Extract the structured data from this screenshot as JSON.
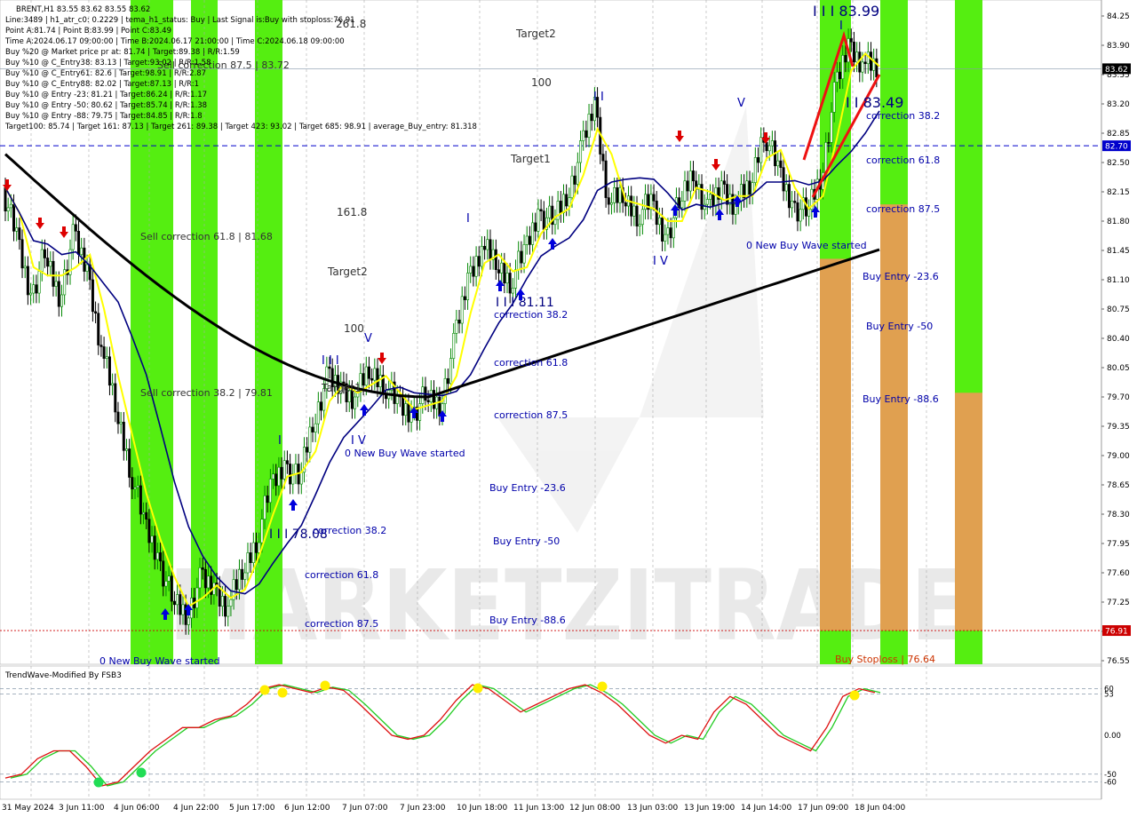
{
  "header": {
    "symbol_line": "BRENT,H1  83.55 83.62 83.55 83.62",
    "info_lines": [
      "Line:3489 | h1_atr_c0: 0.2229 | tema_h1_status: Buy | Last Signal is:Buy with stoploss:76.91",
      "Point A:81.74 | Point B:83.99 | Point C:83.49",
      "Time A:2024.06.17 09:00:00 | Time B:2024.06.17 21:00:00 | Time C:2024.06.18 09:00:00",
      "Buy %20 @ Market price pr at: 81.74 | Target:89.38 | R/R:1.59",
      "Buy %10 @ C_Entry38: 83.13 | Target:93.02 | R/R:1.58",
      "Buy %10 @ C_Entry61: 82.6 | Target:98.91 | R/R:2.87",
      "Buy %10 @ C_Entry88: 82.02 | Target:87.13 | R/R:1",
      "Buy %10 @ Entry -23: 81.21 | Target:86.24 | R/R:1.17",
      "Buy %10 @ Entry -50: 80.62 | Target:85.74 | R/R:1.38",
      "Buy %10 @ Entry -88: 79.75 | Target:84.85 | R/R:1.8",
      "Target100: 85.74 | Target 161: 87.13 | Target 261: 89.38 | Target 423: 93.02 | Target 685: 98.91 | average_Buy_entry: 81.318"
    ]
  },
  "chart_data": {
    "type": "candlestick",
    "symbol": "BRENT",
    "timeframe": "H1",
    "ohlc_last": {
      "open": 83.55,
      "high": 83.62,
      "low": 83.55,
      "close": 83.62
    },
    "ylim": [
      76.55,
      84.25
    ],
    "y_ticks": [
      "84.25",
      "83.90",
      "83.55",
      "83.20",
      "82.85",
      "82.50",
      "82.15",
      "81.80",
      "81.45",
      "81.10",
      "80.75",
      "80.40",
      "80.05",
      "79.70",
      "79.35",
      "79.00",
      "78.65",
      "78.30",
      "77.95",
      "77.60",
      "77.25",
      "76.90",
      "76.55"
    ],
    "x_ticks": [
      "31 May 2024",
      "3 Jun 11:00",
      "4 Jun 06:00",
      "4 Jun 22:00",
      "5 Jun 17:00",
      "6 Jun 12:00",
      "7 Jun 07:00",
      "7 Jun 23:00",
      "10 Jun 18:00",
      "11 Jun 13:00",
      "12 Jun 08:00",
      "13 Jun 03:00",
      "13 Jun 19:00",
      "14 Jun 14:00",
      "17 Jun 09:00",
      "18 Jun 04:00"
    ],
    "close_path": [
      82.2,
      81.6,
      80.9,
      81.4,
      80.9,
      81.6,
      81.2,
      80.3,
      79.6,
      78.9,
      78.2,
      77.8,
      77.3,
      77.1,
      77.5,
      77.4,
      77.2,
      77.6,
      78.0,
      78.6,
      78.9,
      78.7,
      79.4,
      79.9,
      79.8,
      79.7,
      80.0,
      79.9,
      79.6,
      79.5,
      79.7,
      79.6,
      80.3,
      81.1,
      81.5,
      81.3,
      81.1,
      81.4,
      81.9,
      81.8,
      82.1,
      82.6,
      83.2,
      82.0,
      82.1,
      81.9,
      82.0,
      81.6,
      82.0,
      82.4,
      81.9,
      82.2,
      82.0,
      82.2,
      82.9,
      82.4,
      82.0,
      81.9,
      82.3,
      83.3,
      83.9,
      83.7,
      83.6
    ],
    "price_markers": [
      {
        "label": "83.62",
        "value": 83.62,
        "color": "#000000"
      },
      {
        "label": "82.70",
        "value": 82.7,
        "color": "#0000cc"
      },
      {
        "label": "76.91",
        "value": 76.91,
        "color": "#cc0000"
      }
    ],
    "annotations": [
      {
        "text": "I I I 83.99",
        "color": "#000080"
      },
      {
        "text": "I I 83.49",
        "color": "#000080"
      },
      {
        "text": "I I I 81.11",
        "color": "#000080"
      },
      {
        "text": "I I I 78.08",
        "color": "#000080"
      },
      {
        "text": "Target2",
        "color": "#333333"
      },
      {
        "text": "100",
        "color": "#333333"
      },
      {
        "text": "Target1",
        "color": "#333333"
      },
      {
        "text": "161.8",
        "color": "#333333"
      },
      {
        "text": "261.8",
        "color": "#333333"
      },
      {
        "text": "Target2",
        "color": "#333333"
      },
      {
        "text": "100",
        "color": "#333333"
      },
      {
        "text": "Target1",
        "color": "#333333"
      },
      {
        "text": "Sell correction 61.8 | 81.68",
        "color": "#333333"
      },
      {
        "text": "Sell correction 38.2 | 79.81",
        "color": "#333333"
      },
      {
        "text": "Sell correction 87.5 | 83.72",
        "color": "#333333"
      },
      {
        "text": "correction 38.2",
        "color": "#0000aa"
      },
      {
        "text": "correction 61.8",
        "color": "#0000aa"
      },
      {
        "text": "correction 87.5",
        "color": "#0000aa"
      },
      {
        "text": "Buy Entry -23.6",
        "color": "#0000aa"
      },
      {
        "text": "Buy Entry -50",
        "color": "#0000aa"
      },
      {
        "text": "Buy Entry -88.6",
        "color": "#0000aa"
      },
      {
        "text": "correction 38.2",
        "color": "#0000aa"
      },
      {
        "text": "correction 61.8",
        "color": "#0000aa"
      },
      {
        "text": "correction 87.5",
        "color": "#0000aa"
      },
      {
        "text": "Buy Entry -23.6",
        "color": "#0000aa"
      },
      {
        "text": "Buy Entry -50",
        "color": "#0000aa"
      },
      {
        "text": "Buy Entry -88.6",
        "color": "#0000aa"
      },
      {
        "text": "correction 38.2",
        "color": "#0000aa"
      },
      {
        "text": "correction 61.8",
        "color": "#0000aa"
      },
      {
        "text": "correction 87.5",
        "color": "#0000aa"
      },
      {
        "text": "0 New Buy Wave started",
        "color": "#0000aa"
      },
      {
        "text": "0 New Buy Wave started",
        "color": "#0000aa"
      },
      {
        "text": "0 New Buy Wave started",
        "color": "#0000aa"
      },
      {
        "text": "Buy Stoploss | 76.64",
        "color": "#cc3300"
      },
      {
        "text": "I V",
        "color": "#0000aa"
      },
      {
        "text": "I V",
        "color": "#0000aa"
      },
      {
        "text": "V",
        "color": "#0000aa"
      },
      {
        "text": "V",
        "color": "#0000aa"
      },
      {
        "text": "I",
        "color": "#0000aa"
      },
      {
        "text": "I",
        "color": "#0000aa"
      },
      {
        "text": "I I I",
        "color": "#0000aa"
      },
      {
        "text": "I I",
        "color": "#0000aa"
      },
      {
        "text": "I",
        "color": "#0000aa"
      }
    ],
    "watermark": "MARKETZITRADE",
    "colors": {
      "bull": "#008800",
      "bear": "#000000",
      "ema_black": "#000000",
      "ema_blue": "#000080",
      "yellow": "#ffff00",
      "green_zone": "#55ee11",
      "orange_zone": "#e0a050"
    }
  },
  "oscillator": {
    "title": "TrendWave-Modified By FSB3",
    "ylim": [
      -80,
      80
    ],
    "y_ticks": [
      "60",
      "53",
      "0.00",
      "-50",
      "-60"
    ],
    "red_line": [
      -55,
      -50,
      -30,
      -20,
      -20,
      -40,
      -65,
      -60,
      -40,
      -20,
      -5,
      10,
      10,
      20,
      25,
      40,
      60,
      65,
      60,
      55,
      62,
      58,
      40,
      20,
      0,
      -5,
      0,
      20,
      45,
      65,
      60,
      45,
      30,
      40,
      50,
      60,
      65,
      55,
      40,
      20,
      0,
      -10,
      0,
      -5,
      30,
      50,
      40,
      20,
      0,
      -10,
      -20,
      10,
      50,
      60,
      55
    ],
    "yellow_dots": [
      3,
      4,
      6,
      10,
      14,
      20
    ],
    "green_dots": [
      1,
      2
    ]
  }
}
